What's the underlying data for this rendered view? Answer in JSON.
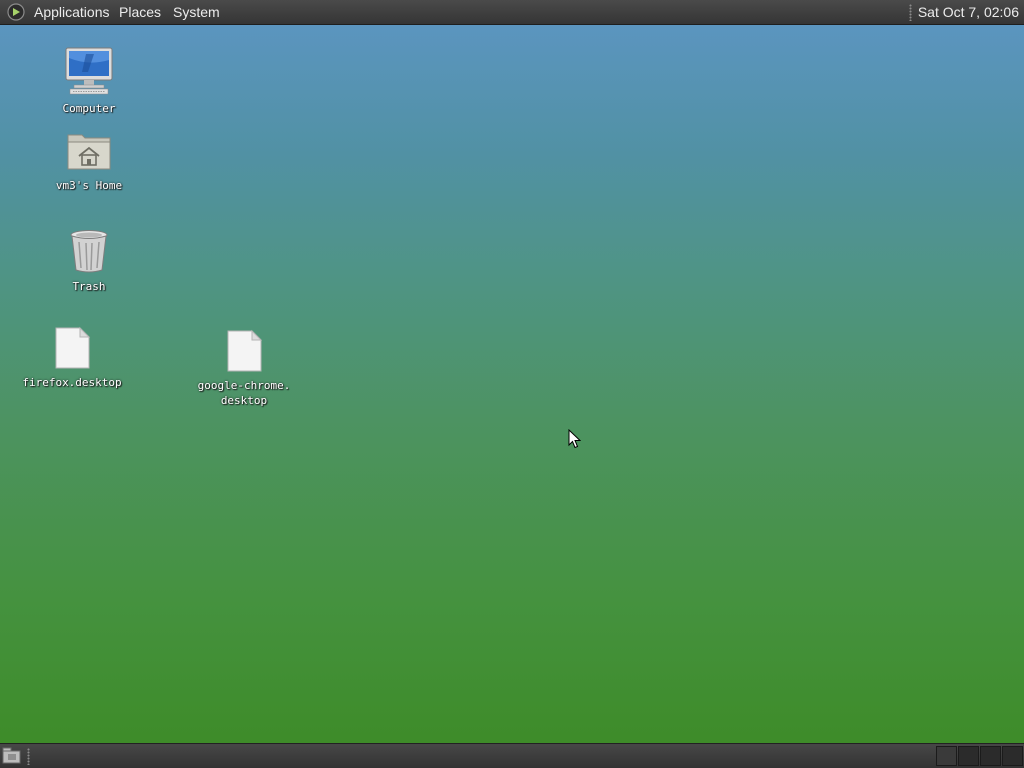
{
  "top_panel": {
    "menus": {
      "applications": "Applications",
      "places": "Places",
      "system": "System"
    },
    "clock": "Sat Oct  7, 02:06"
  },
  "desktop": {
    "icons": [
      {
        "label": "Computer",
        "icon": "computer-icon"
      },
      {
        "label": "vm3's Home",
        "icon": "home-folder-icon"
      },
      {
        "label": "Trash",
        "icon": "trash-icon"
      },
      {
        "label": "firefox.desktop",
        "icon": "file-icon"
      },
      {
        "label": "google-chrome.\ndesktop",
        "icon": "file-icon"
      }
    ]
  },
  "bottom_panel": {
    "workspace_count": 4,
    "active_workspace": 1
  },
  "colors": {
    "panel": "#3d3d3d",
    "desktop_top": "#5b95bf",
    "desktop_bottom": "#3e8c29",
    "label_text": "#ffffff"
  }
}
